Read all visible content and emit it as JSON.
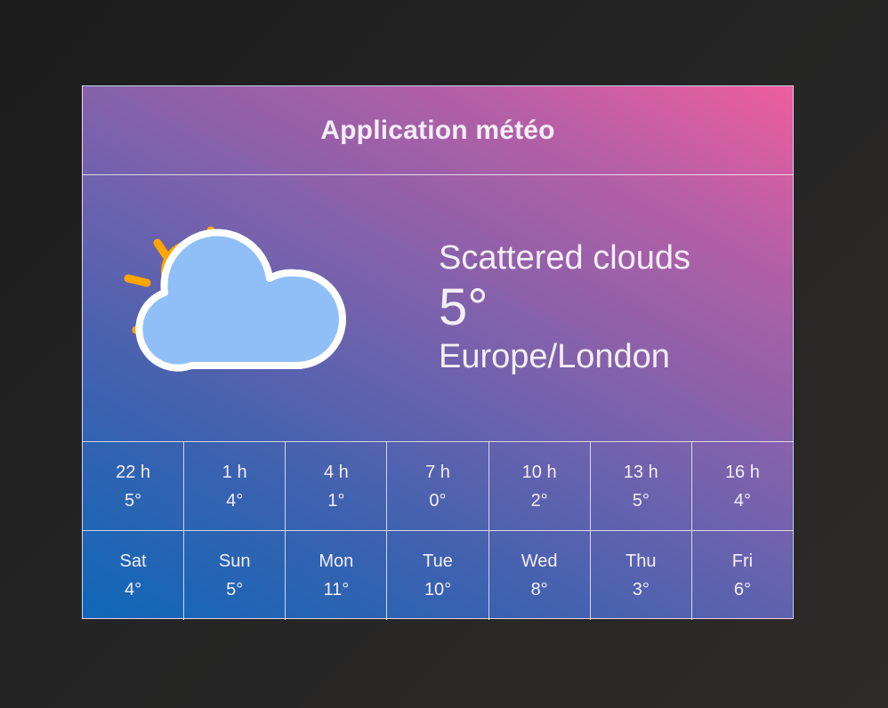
{
  "app": {
    "title": "Application météo"
  },
  "current": {
    "icon": "scattered-clouds-icon",
    "description": "Scattered clouds",
    "temperature": "5°",
    "timezone": "Europe/London"
  },
  "hourly": [
    {
      "time": "22 h",
      "temp": "5°"
    },
    {
      "time": "1 h",
      "temp": "4°"
    },
    {
      "time": "4 h",
      "temp": "1°"
    },
    {
      "time": "7 h",
      "temp": "0°"
    },
    {
      "time": "10 h",
      "temp": "2°"
    },
    {
      "time": "13 h",
      "temp": "5°"
    },
    {
      "time": "16 h",
      "temp": "4°"
    }
  ],
  "daily": [
    {
      "day": "Sat",
      "temp": "4°"
    },
    {
      "day": "Sun",
      "temp": "5°"
    },
    {
      "day": "Mon",
      "temp": "11°"
    },
    {
      "day": "Tue",
      "temp": "10°"
    },
    {
      "day": "Wed",
      "temp": "8°"
    },
    {
      "day": "Thu",
      "temp": "3°"
    },
    {
      "day": "Fri",
      "temp": "6°"
    }
  ],
  "colors": {
    "sun": "#ffa500",
    "cloud": "#90bff7",
    "gradient_start": "#0f67b8",
    "gradient_end": "#ed5e9f"
  }
}
